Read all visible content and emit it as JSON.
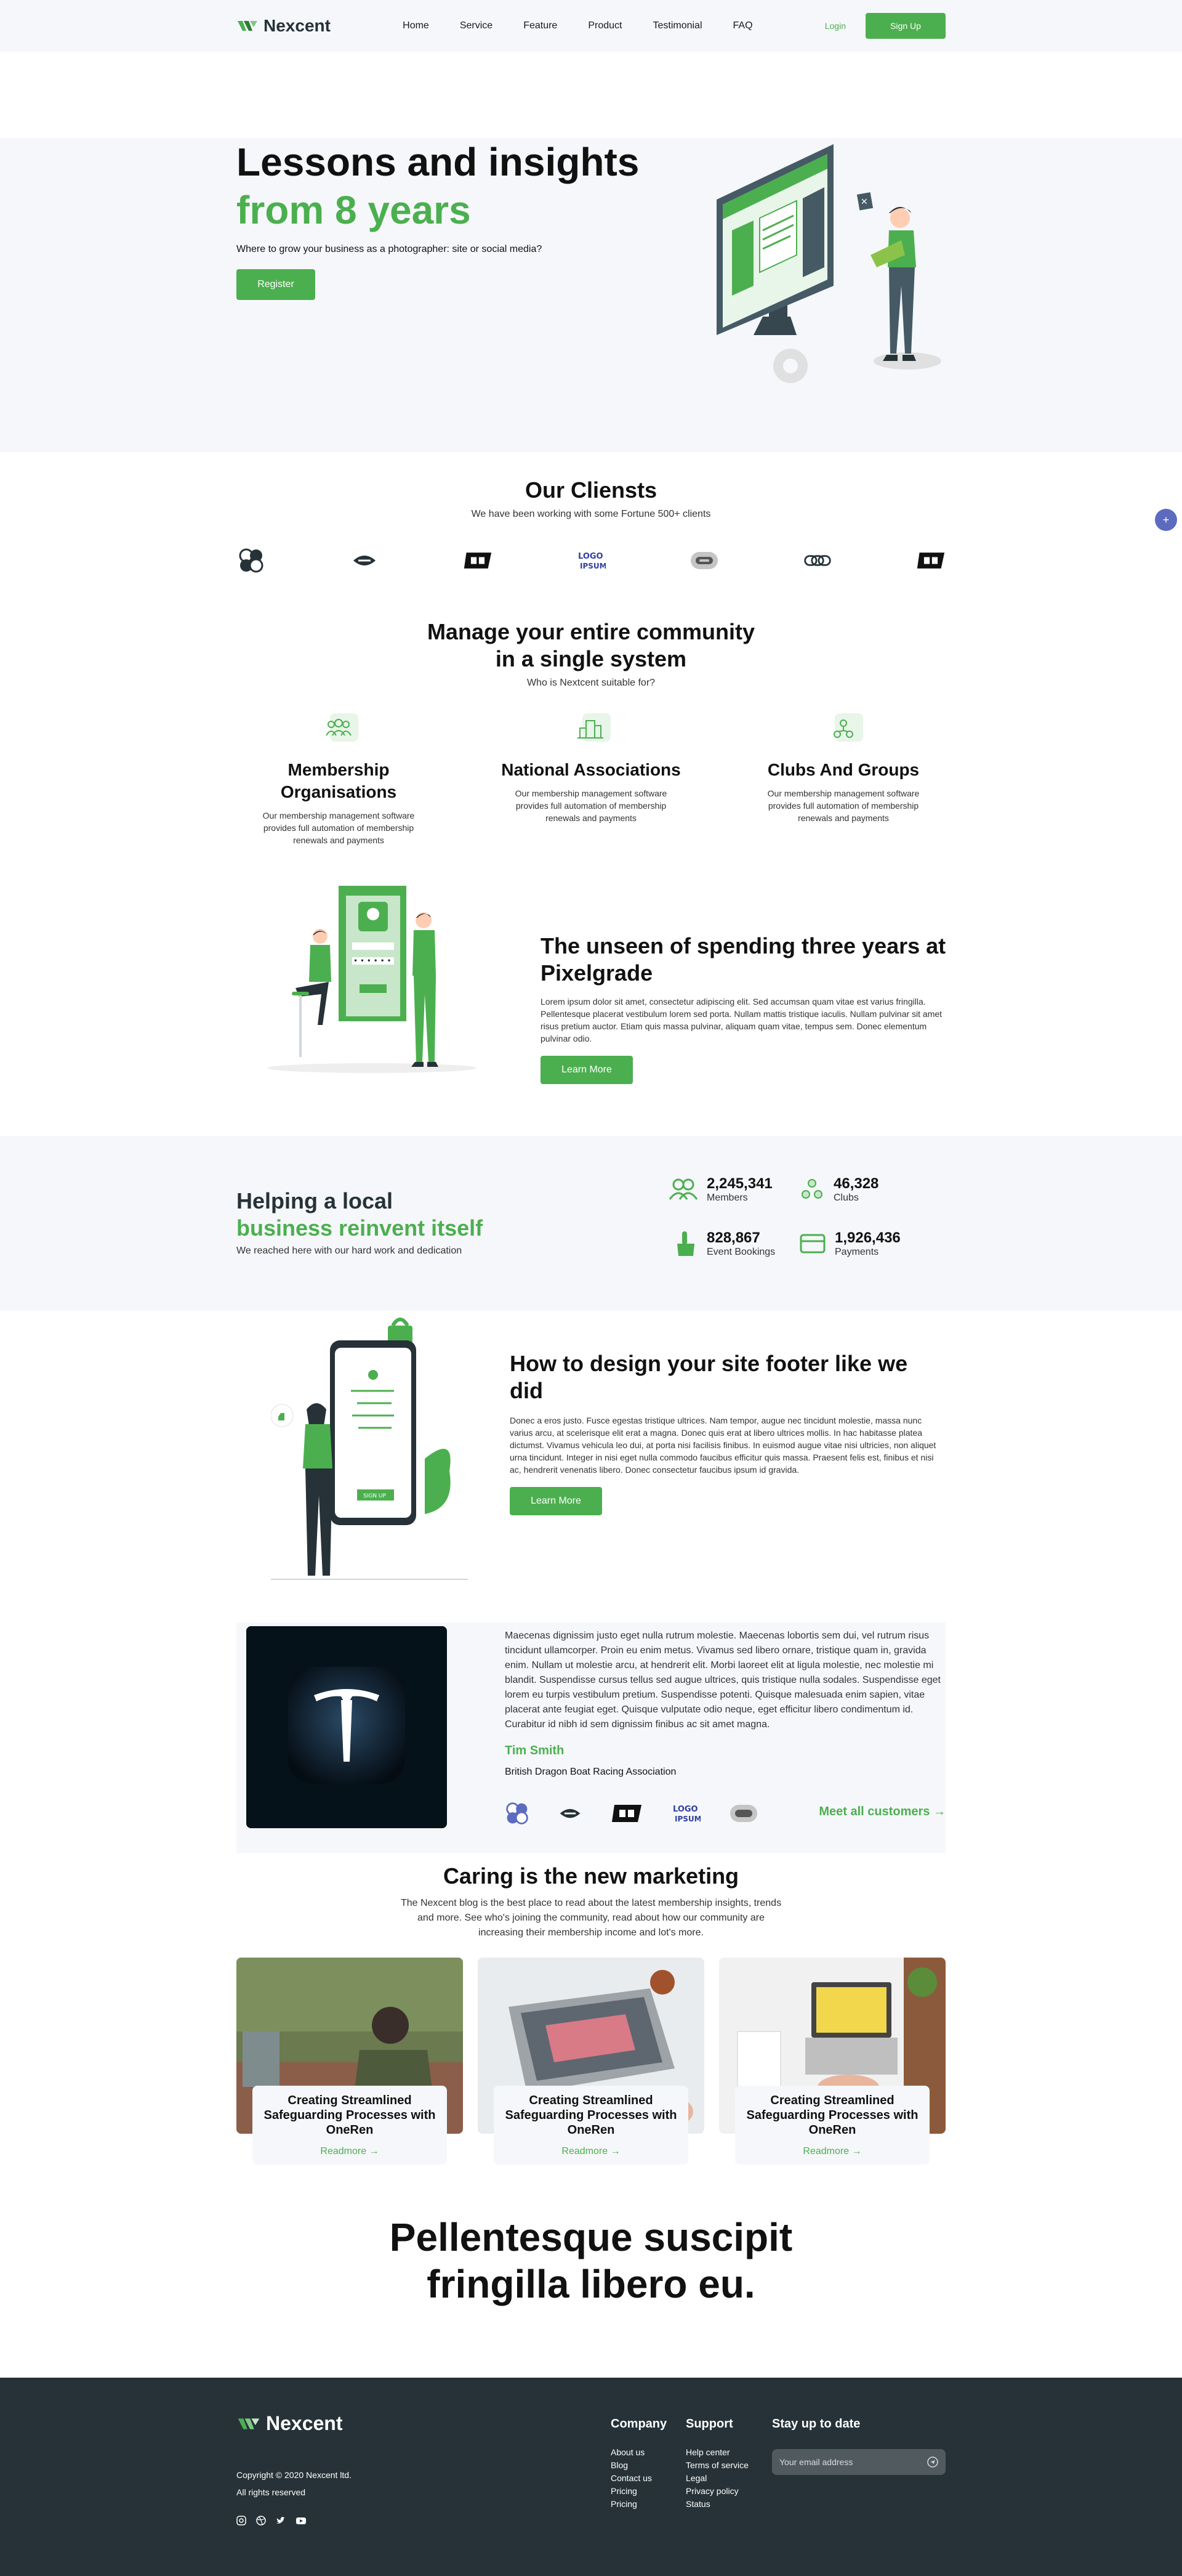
{
  "nav": {
    "brand": "Nexcent",
    "links": [
      "Home",
      "Service",
      "Feature",
      "Product",
      "Testimonial",
      "FAQ"
    ],
    "login": "Login",
    "signup": "Sign Up"
  },
  "hero": {
    "title_line1": "Lessons and insights",
    "title_line2": "from 8 years",
    "subtitle": "Where to grow your business as a photographer: site or social media?",
    "cta": "Register"
  },
  "clients": {
    "title": "Our Cliensts",
    "subtitle": "We have been working with some Fortune 500+ clients"
  },
  "community": {
    "title_line1": "Manage your entire community",
    "title_line2": "in a single system",
    "subtitle": "Who is Nextcent suitable for?",
    "features": [
      {
        "title": "Membership Organisations",
        "desc": "Our membership management software provides full automation of membership renewals and payments"
      },
      {
        "title": "National Associations",
        "desc": "Our membership management software provides full automation of membership renewals and payments"
      },
      {
        "title": "Clubs And Groups",
        "desc": "Our membership management software provides full automation of membership renewals and payments"
      }
    ]
  },
  "unseen": {
    "title": "The unseen of spending three years at Pixelgrade",
    "body": "Lorem ipsum dolor sit amet, consectetur adipiscing elit. Sed accumsan quam vitae est varius fringilla. Pellentesque placerat vestibulum lorem sed porta. Nullam mattis tristique iaculis. Nullam pulvinar sit amet risus pretium auctor. Etiam quis massa pulvinar, aliquam quam vitae, tempus sem. Donec elementum pulvinar odio.",
    "cta": "Learn More"
  },
  "stats": {
    "title_line1": "Helping a local",
    "title_line2": "business reinvent itself",
    "subtitle": "We reached here with our hard work and dedication",
    "items": [
      {
        "value": "2,245,341",
        "label": "Members"
      },
      {
        "value": "46,328",
        "label": "Clubs"
      },
      {
        "value": "828,867",
        "label": "Event Bookings"
      },
      {
        "value": "1,926,436",
        "label": "Payments"
      }
    ]
  },
  "design": {
    "title": "How to design your site footer like we did",
    "body": "Donec a eros justo. Fusce egestas tristique ultrices. Nam tempor, augue nec tincidunt molestie, massa nunc varius arcu, at scelerisque elit erat a magna. Donec quis erat at libero ultrices mollis. In hac habitasse platea dictumst. Vivamus vehicula leo dui, at porta nisi facilisis finibus. In euismod augue vitae nisi ultricies, non aliquet urna tincidunt. Integer in nisi eget nulla commodo faucibus efficitur quis massa. Praesent felis est, finibus et nisi ac, hendrerit venenatis libero. Donec consectetur faucibus ipsum id gravida.",
    "cta": "Learn More",
    "illu_button": "SIGN UP"
  },
  "testimonial": {
    "quote": "Maecenas dignissim justo eget nulla rutrum molestie. Maecenas lobortis sem dui, vel rutrum risus tincidunt ullamcorper. Proin eu enim metus. Vivamus sed libero ornare, tristique quam in, gravida enim. Nullam ut molestie arcu, at hendrerit elit. Morbi laoreet elit at ligula molestie, nec molestie mi blandit. Suspendisse cursus tellus sed augue ultrices, quis tristique nulla sodales. Suspendisse eget lorem eu turpis vestibulum pretium. Suspendisse potenti. Quisque malesuada enim sapien, vitae placerat ante feugiat eget. Quisque vulputate odio neque, eget efficitur libero condimentum id. Curabitur id nibh id sem dignissim finibus ac sit amet magna.",
    "name": "Tim Smith",
    "org": "British Dragon Boat Racing Association",
    "more": "Meet all customers"
  },
  "blog": {
    "title": "Caring is the new marketing",
    "subtitle": "The Nexcent blog is the best place to read about the latest membership insights, trends and more. See who's joining the community, read about how our community are increasing their membership income and lot's more.",
    "cards": [
      {
        "title": "Creating Streamlined Safeguarding Processes with OneRen",
        "link": "Readmore"
      },
      {
        "title": "Creating Streamlined Safeguarding Processes with OneRen",
        "link": "Readmore"
      },
      {
        "title": "Creating Streamlined Safeguarding Processes with OneRen",
        "link": "Readmore"
      }
    ]
  },
  "cta_section": {
    "line1": "Pellentesque suscipit",
    "line2": "fringilla libero eu."
  },
  "footer": {
    "brand": "Nexcent",
    "copyright": "Copyright © 2020 Nexcent ltd.",
    "rights": "All rights reserved",
    "company_title": "Company",
    "company_links": [
      "About us",
      "Blog",
      "Contact us",
      "Pricing",
      "Pricing"
    ],
    "support_title": "Support",
    "support_links": [
      "Help center",
      "Terms of service",
      "Legal",
      "Privacy policy",
      "Status"
    ],
    "newsletter_title": "Stay up to date",
    "email_placeholder": "Your email address"
  },
  "colors": {
    "brand": "#4CAF4F",
    "dark": "#263238",
    "silver": "#F5F7FA"
  }
}
